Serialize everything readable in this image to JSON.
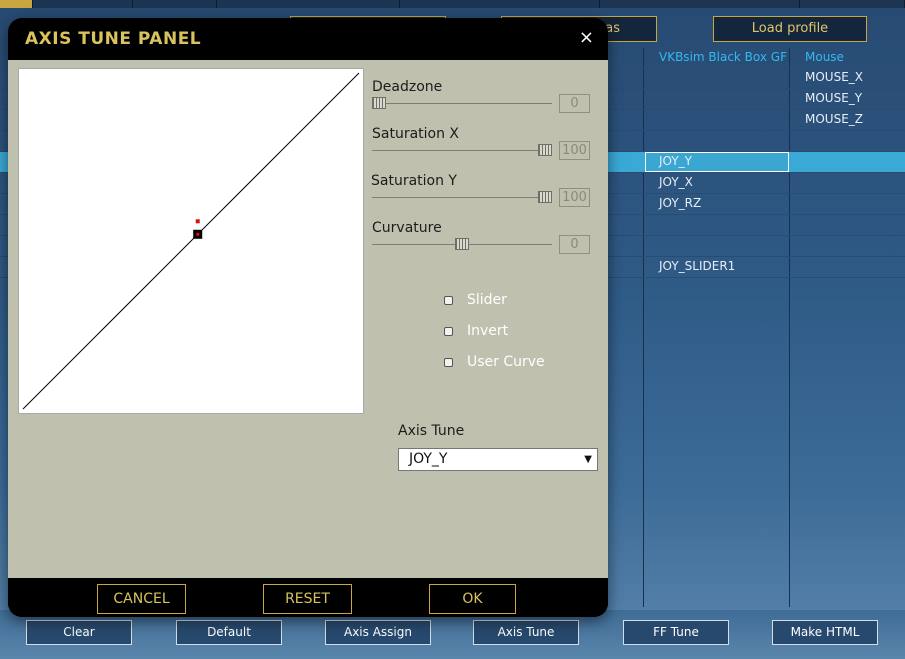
{
  "background": {
    "top_buttons": [
      {
        "label": "",
        "name": "top-button-1"
      },
      {
        "label": "as",
        "name": "top-button-save-as"
      },
      {
        "label": "Load profile",
        "name": "top-button-load-profile"
      }
    ],
    "columns": [
      "VKBsim Black Box GF",
      "Mouse"
    ],
    "mouse_cells": [
      "MOUSE_X",
      "MOUSE_Y",
      "MOUSE_Z"
    ],
    "device_cells": [
      "JOY_Y",
      "JOY_X",
      "JOY_RZ",
      "JOY_SLIDER1"
    ],
    "bottom_buttons": [
      "Clear",
      "Default",
      "Axis Assign",
      "Axis Tune",
      "FF Tune",
      "Make HTML"
    ]
  },
  "dialog": {
    "title": "AXIS TUNE PANEL",
    "close_icon": "×",
    "sliders": [
      {
        "label": "Deadzone",
        "value": "0",
        "fraction": 0.0
      },
      {
        "label": "Saturation X",
        "value": "100",
        "fraction": 1.0
      },
      {
        "label": "Saturation Y",
        "value": "100",
        "fraction": 1.0
      },
      {
        "label": "Curvature",
        "value": "0",
        "fraction": 0.5
      }
    ],
    "checkboxes": [
      {
        "label": "Slider",
        "checked": false
      },
      {
        "label": "Invert",
        "checked": false
      },
      {
        "label": "User Curve",
        "checked": false
      }
    ],
    "axis_tune_label": "Axis Tune",
    "axis_select_value": "JOY_Y",
    "axis_select_arrow": "▼",
    "buttons": {
      "cancel": "CANCEL",
      "reset": "RESET",
      "ok": "OK"
    },
    "curve": {
      "marker_fraction": 0.52
    }
  },
  "colors": {
    "title_gold": "#d9c35c",
    "panel_bg": "#bfc0ae",
    "highlight": "#39a9d6",
    "header_blue": "#37b7f0"
  }
}
